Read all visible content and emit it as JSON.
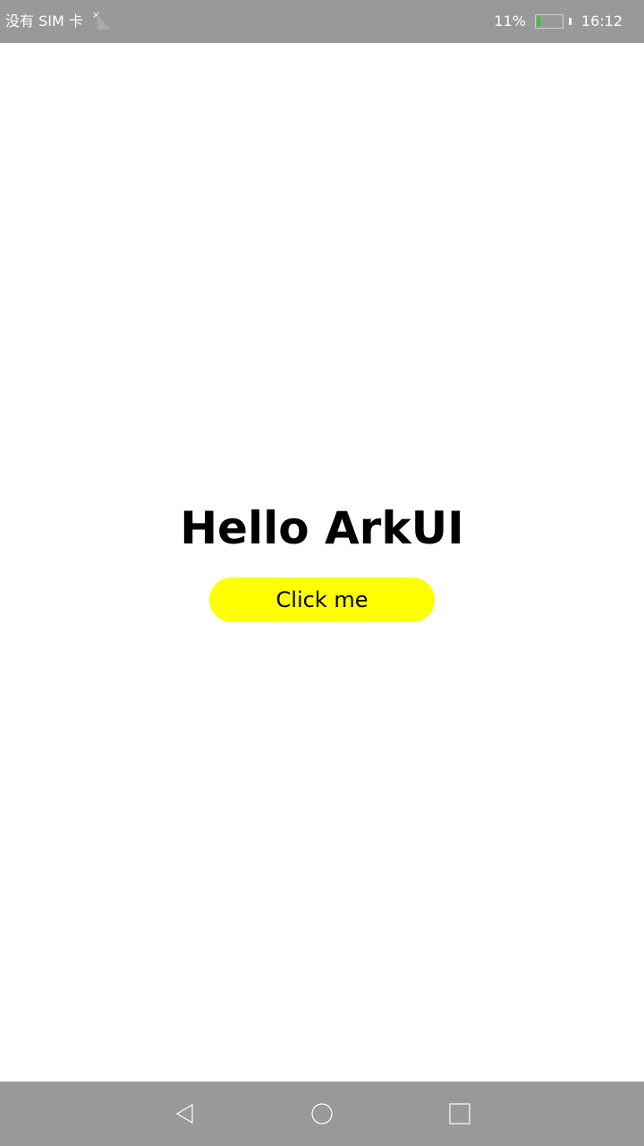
{
  "status_bar": {
    "carrier": "没有 SIM 卡",
    "sim_badge": "×",
    "battery_percent": "11%",
    "battery_level": 0.11,
    "time": "16:12",
    "battery_fill_color": "#22cc22"
  },
  "main": {
    "title": "Hello ArkUI",
    "button_label": "Click me",
    "button_color": "#ffff00"
  },
  "nav_bar": {
    "icons": [
      "back-triangle-icon",
      "home-circle-icon",
      "recent-square-icon"
    ]
  }
}
